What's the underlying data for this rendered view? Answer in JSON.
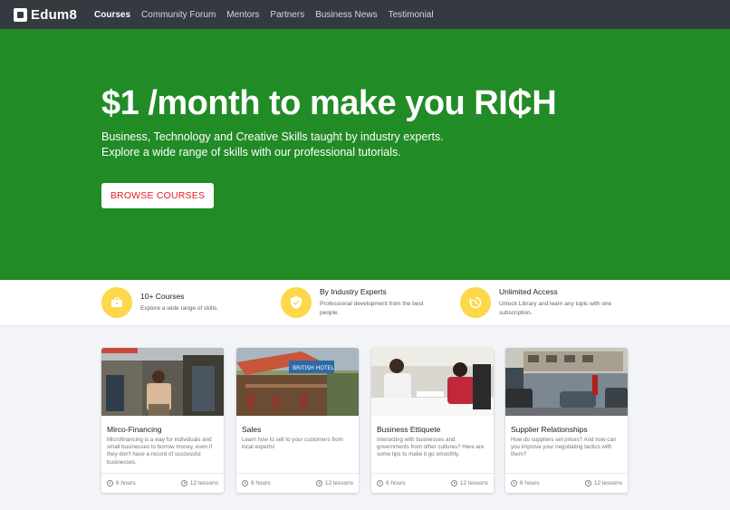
{
  "nav": {
    "brand": "Edum8",
    "brand_icon": "edum8-logo-icon",
    "links": [
      {
        "label": "Courses",
        "active": true
      },
      {
        "label": "Community Forum"
      },
      {
        "label": "Mentors"
      },
      {
        "label": "Partners"
      },
      {
        "label": "Business News"
      },
      {
        "label": "Testimonial"
      }
    ]
  },
  "hero": {
    "background": "#218b26",
    "title": "$1 /month to make you RI₵H",
    "subtitle_line1": "Business, Technology and Creative Skills taught by industry experts.",
    "subtitle_line2": "Explore a wide range of skills with our professional tutorials.",
    "cta_label": "BROWSE COURSES",
    "cta_color": "#e31e24"
  },
  "features": [
    {
      "icon": "briefcase-icon",
      "title": "10+ Courses",
      "desc": "Explore a wide range of skills."
    },
    {
      "icon": "shield-check-icon",
      "title": "By Industry Experts",
      "desc": "Professional development from the best people."
    },
    {
      "icon": "refresh-clock-icon",
      "title": "Unlimited Access",
      "desc": "Unlock Library and learn any topic with one subscription."
    }
  ],
  "feature_icon_color": "#fcd84a",
  "courses": [
    {
      "title": "Mirco-Financing",
      "desc": "Microfinancing is a way for individuals and small businesses to borrow money, even if they don't have a record of successful businesses.",
      "hours": "6 hours",
      "lessons": "12 lessons"
    },
    {
      "title": "Sales",
      "desc": "Learn how to sell to your customers from local experts!",
      "hours": "6 hours",
      "lessons": "12 lessons",
      "sign_text": "BRITISH HOTEL"
    },
    {
      "title": "Business Ettiquete",
      "desc": "Interacting with businesses and governments from other cultures? Here are some tips to make it go smoothly.",
      "hours": "6 hours",
      "lessons": "12 lessons"
    },
    {
      "title": "Supplier Relationships",
      "desc": "How do suppliers set prices? And how can you improve your negotiating tactics with them?",
      "hours": "6 hours",
      "lessons": "12 lessons"
    }
  ]
}
